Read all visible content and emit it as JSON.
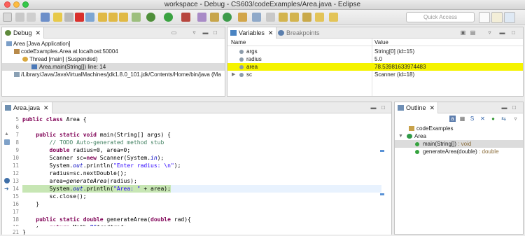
{
  "window": {
    "title": "workspace - Debug - CS603/codeExamples/Area.java - Eclipse"
  },
  "toolbar": {
    "quick_access_placeholder": "Quick Access"
  },
  "debug_view": {
    "tab_label": "Debug",
    "rows": [
      "Area [Java Application]",
      "codeExamples.Area at localhost:50004",
      "Thread [main] (Suspended)",
      "Area.main(String[]) line: 14",
      "/Library/Java/JavaVirtualMachines/jdk1.8.0_101.jdk/Contents/Home/bin/java (Ma"
    ]
  },
  "variables_view": {
    "tab_label": "Variables",
    "inactive_tab_label": "Breakpoints",
    "headers": {
      "name": "Name",
      "value": "Value"
    },
    "rows": [
      {
        "name": "args",
        "value": "String[0]  (id=15)"
      },
      {
        "name": "radius",
        "value": "5.0"
      },
      {
        "name": "area",
        "value": "78.53981633974483"
      },
      {
        "name": "sc",
        "value": "Scanner  (id=18)"
      }
    ]
  },
  "editor": {
    "tab_label": "Area.java",
    "line_numbers": [
      "5",
      "6",
      "7",
      "8",
      "9",
      "10",
      "11",
      "12",
      "13",
      "14",
      "15",
      "16",
      "17",
      "18",
      "19",
      "20",
      "21"
    ],
    "line_texts": {
      "l5_kw": "public class",
      "l5_rest": " Area {",
      "l7_pre": "    ",
      "l7_kw": "public static void",
      "l7_rest": " main(String[] args) {",
      "l8_comment": "        // TODO Auto-generated method stub",
      "l9_pre": "        ",
      "l9_kw": "double",
      "l9_rest": " radius=0, area=0;",
      "l10_a": "        Scanner sc=",
      "l10_kw": "new",
      "l10_b": " Scanner(System.",
      "l10_field": "in",
      "l10_c": ");",
      "l11_a": "        System.",
      "l11_field": "out",
      "l11_b": ".println(",
      "l11_str": "\"Enter radius: \\n\"",
      "l11_c": ");",
      "l12": "        radius=sc.nextDouble();",
      "l13_a": "        area=",
      "l13_it": "generateArea",
      "l13_b": "(radius);",
      "l14_a": "        System.",
      "l14_field": "out",
      "l14_b": ".println(",
      "l14_str": "\"Area: \"",
      "l14_c": " + area);",
      "l15": "        sc.close();",
      "l16": "    }",
      "l18_pre": "    ",
      "l18_kw": "public static double",
      "l18_rest": " generateArea(",
      "l18_kw2": "double",
      "l18_end": " rad){",
      "l19_pre": "        ",
      "l19_kw": "return",
      "l19_a": " Math.",
      "l19_field": "PI",
      "l19_b": "*rad*rad;",
      "l20": "    }",
      "l21": "}"
    }
  },
  "outline_view": {
    "tab_label": "Outline",
    "rows": [
      {
        "label": "codeExamples",
        "suffix": ""
      },
      {
        "label": "Area",
        "suffix": ""
      },
      {
        "label": "main(String[])",
        "suffix": " : void"
      },
      {
        "label": "generateArea(double)",
        "suffix": " : double"
      }
    ]
  },
  "colors": {
    "highlight_yellow": "#f5f300",
    "current_line_green": "#c7e6b4",
    "keyword": "#7f0055",
    "comment": "#3f7f5f",
    "string": "#2a00ff"
  }
}
